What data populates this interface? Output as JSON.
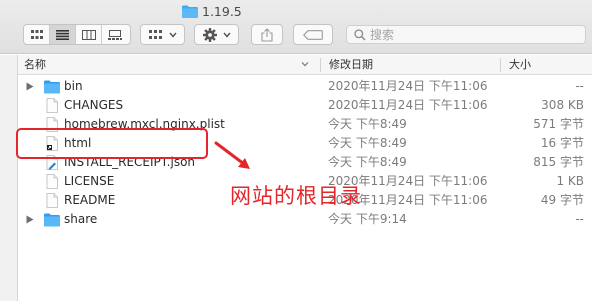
{
  "window": {
    "title": "1.19.5"
  },
  "toolbar": {
    "search_placeholder": "搜索"
  },
  "columns": {
    "name": "名称",
    "date": "修改日期",
    "size": "大小"
  },
  "files": [
    {
      "name": "bin",
      "date": "2020年11月24日 下午11:06",
      "size": "--",
      "kind": "folder",
      "expandable": true
    },
    {
      "name": "CHANGES",
      "date": "2020年11月24日 下午11:06",
      "size": "308 KB",
      "kind": "doc",
      "expandable": false
    },
    {
      "name": "homebrew.mxcl.nginx.plist",
      "date": "今天 下午8:49",
      "size": "571 字节",
      "kind": "doc",
      "expandable": false
    },
    {
      "name": "html",
      "date": "今天 下午8:49",
      "size": "16 字节",
      "kind": "alias",
      "expandable": false
    },
    {
      "name": "INSTALL_RECEIPT.json",
      "date": "今天 下午8:49",
      "size": "815 字节",
      "kind": "json",
      "expandable": false
    },
    {
      "name": "LICENSE",
      "date": "2020年11月24日 下午11:06",
      "size": "1 KB",
      "kind": "doc",
      "expandable": false
    },
    {
      "name": "README",
      "date": "2020年11月24日 下午11:06",
      "size": "49 字节",
      "kind": "doc",
      "expandable": false
    },
    {
      "name": "share",
      "date": "今天 下午9:14",
      "size": "--",
      "kind": "folder",
      "expandable": true
    }
  ],
  "annotation": {
    "text": "网站的根目录",
    "color": "#e3262a"
  },
  "colors": {
    "folder": "#3fa9f5",
    "accent_red": "#e3262a"
  }
}
